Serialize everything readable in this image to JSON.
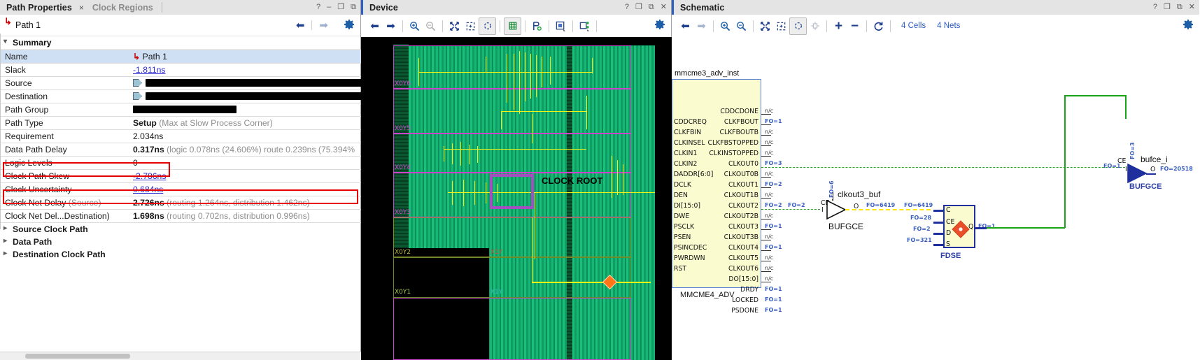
{
  "path_properties": {
    "tab_active": "Path Properties",
    "tab_close": "×",
    "tab_inactive": "Clock Regions",
    "window_controls": [
      "?",
      "–",
      "❐",
      "⧉"
    ],
    "subheader": {
      "path_label": "Path 1",
      "icon": "path-arrow-icon"
    },
    "section_summary": "Summary",
    "rows": [
      {
        "key": "Name",
        "key_sub": "",
        "value": "Path 1",
        "value_suffix": "",
        "style": "selected-with-icon"
      },
      {
        "key": "Slack",
        "key_sub": "",
        "value": "-1.811ns",
        "value_suffix": "",
        "style": "link"
      },
      {
        "key": "Source",
        "key_sub": "",
        "value": "",
        "value_suffix": "",
        "style": "redacted",
        "redact_width": 326,
        "pin": true
      },
      {
        "key": "Destination",
        "key_sub": "",
        "value": "",
        "value_suffix": "",
        "style": "redacted",
        "redact_width": 322,
        "pin": true
      },
      {
        "key": "Path Group",
        "key_sub": "",
        "value": "",
        "value_suffix": "",
        "style": "redacted",
        "redact_width": 148,
        "pin": false
      },
      {
        "key": "Path Type",
        "key_sub": "",
        "value": "Setup",
        "value_suffix": "(Max at Slow Process Corner)",
        "style": "bold-plus-muted"
      },
      {
        "key": "Requirement",
        "key_sub": "",
        "value": "2.034ns",
        "value_suffix": "",
        "style": "plain"
      },
      {
        "key": "Data Path Delay",
        "key_sub": "",
        "value": "0.317ns",
        "value_suffix": "(logic 0.078ns (24.606%)  route 0.239ns (75.394%",
        "style": "bold-plus-muted"
      },
      {
        "key": "Logic Levels",
        "key_sub": "",
        "value": "0",
        "value_suffix": "",
        "style": "plain"
      },
      {
        "key": "Clock Path Skew",
        "key_sub": "",
        "value": "-2.786ns",
        "value_suffix": "",
        "style": "link"
      },
      {
        "key": "Clock Uncertainty",
        "key_sub": "",
        "value": "0.684ns",
        "value_suffix": "",
        "style": "link"
      },
      {
        "key": "Clock Net Delay",
        "key_sub": "(Source)",
        "value": "2.726ns",
        "value_suffix": "(routing 1.264ns, distribution 1.462ns)",
        "style": "bold-plus-muted"
      },
      {
        "key": "Clock Net Del...Destination)",
        "key_sub": "",
        "value": "1.698ns",
        "value_suffix": "(routing 0.702ns, distribution 0.996ns)",
        "style": "bold-plus-muted"
      }
    ],
    "groups": [
      "Source Clock Path",
      "Data Path",
      "Destination Clock Path"
    ],
    "highlight_color": "#e60000",
    "nav": {
      "back": "⬅",
      "forward": "➡",
      "settings": "gear-icon"
    }
  },
  "device": {
    "title": "Device",
    "window_controls": [
      "?",
      "❐",
      "⧉",
      "✕"
    ],
    "toolbar_icons": [
      "back-arrow-icon",
      "forward-arrow-icon",
      "zoom-in-icon",
      "zoom-out-icon",
      "zoom-fit-icon",
      "zoom-area-icon",
      "autofit-selection-icon",
      "routing-resources-icon",
      "add-probe-icon",
      "highlight-leaf-icon",
      "mark-icon",
      "gear-icon"
    ],
    "clock_regions": [
      "X0Y6",
      "X0Y5",
      "X0Y4",
      "X0Y3",
      "X0Y2",
      "X1Y",
      "X0Y1",
      "X1Y"
    ],
    "annotation": "CLOCK ROOT",
    "colors": {
      "fabric": "#12b272",
      "routes": "#f3f11a",
      "region_outline": "#cc44cc",
      "clock_root_box": "#a24fbf",
      "marker": "#ff7518"
    }
  },
  "schematic": {
    "title": "Schematic",
    "window_controls": [
      "?",
      "❐",
      "⧉",
      "✕"
    ],
    "toolbar_icons": [
      "back-arrow-icon",
      "forward-arrow-icon",
      "zoom-in-icon",
      "zoom-out-icon",
      "zoom-fit-icon",
      "zoom-area-icon",
      "autofit-selection-icon",
      "expand-cone-icon",
      "add-icon",
      "remove-icon",
      "reload-icon",
      "gear-icon"
    ],
    "stats": {
      "cells": "4 Cells",
      "nets": "4 Nets"
    },
    "mmcm": {
      "instance_name": "mmcme3_adv_inst",
      "cell_type": "MMCME4_ADV",
      "input_pins": [
        "CDDCREQ",
        "CLKFBIN",
        "CLKINSEL",
        "CLKIN1",
        "CLKIN2",
        "DADDR[6:0]",
        "DCLK",
        "DEN",
        "DI[15:0]",
        "DWE",
        "PSCLK",
        "PSEN",
        "PSINCDEC",
        "PWRDWN",
        "RST"
      ],
      "output_pins": [
        {
          "name": "CDDCDONE",
          "fanout": "n/c"
        },
        {
          "name": "CLKFBOUT",
          "fanout": "FO=1"
        },
        {
          "name": "CLKFBOUTB",
          "fanout": "n/c"
        },
        {
          "name": "CLKFBSTOPPED",
          "fanout": "n/c"
        },
        {
          "name": "CLKINSTOPPED",
          "fanout": "n/c"
        },
        {
          "name": "CLKOUT0",
          "fanout": "FO=3"
        },
        {
          "name": "CLKOUT0B",
          "fanout": "n/c"
        },
        {
          "name": "CLKOUT1",
          "fanout": "FO=2"
        },
        {
          "name": "CLKOUT1B",
          "fanout": "n/c"
        },
        {
          "name": "CLKOUT2",
          "fanout": "FO=2"
        },
        {
          "name": "CLKOUT2B",
          "fanout": "n/c"
        },
        {
          "name": "CLKOUT3",
          "fanout": "FO=1"
        },
        {
          "name": "CLKOUT3B",
          "fanout": "n/c"
        },
        {
          "name": "CLKOUT4",
          "fanout": "FO=1"
        },
        {
          "name": "CLKOUT5",
          "fanout": "n/c"
        },
        {
          "name": "CLKOUT6",
          "fanout": "n/c"
        },
        {
          "name": "DO[15:0]",
          "fanout": "n/c"
        },
        {
          "name": "DRDY",
          "fanout": "FO=1"
        },
        {
          "name": "LOCKED",
          "fanout": "FO=1"
        },
        {
          "name": "PSDONE",
          "fanout": "FO=1"
        }
      ]
    },
    "bufgce_left": {
      "instance_name": "clkout3_buf",
      "cell_type": "BUFGCE",
      "pin_ce": "CE",
      "pin_i": "I",
      "pin_o": "O",
      "fo_ce": "FO=6",
      "fo_in": "FO=2",
      "fo_out": "FO=6419"
    },
    "fdse": {
      "cell_type": "FDSE",
      "pins": [
        "C",
        "CE",
        "D",
        "S",
        "Q"
      ],
      "fo_c": "FO=6419",
      "fo_ce": "FO=28",
      "fo_d": "FO=2",
      "fo_s": "FO=321",
      "fo_q": "FO=1"
    },
    "bufgce_right": {
      "instance_name": "bufce_i",
      "cell_type": "BUFGCE",
      "pin_ce": "CE",
      "pin_i": "I",
      "pin_o": "O",
      "fo_ce": "FO=3",
      "fo_i": "FO=1",
      "fo_out": "FO=20518"
    },
    "colors": {
      "block_fill": "#fbfbd0",
      "block_border": "#1f2f9e",
      "net_green": "#19a319",
      "net_yellow": "#ffe500",
      "fanout_text": "#2b3fa8"
    }
  }
}
